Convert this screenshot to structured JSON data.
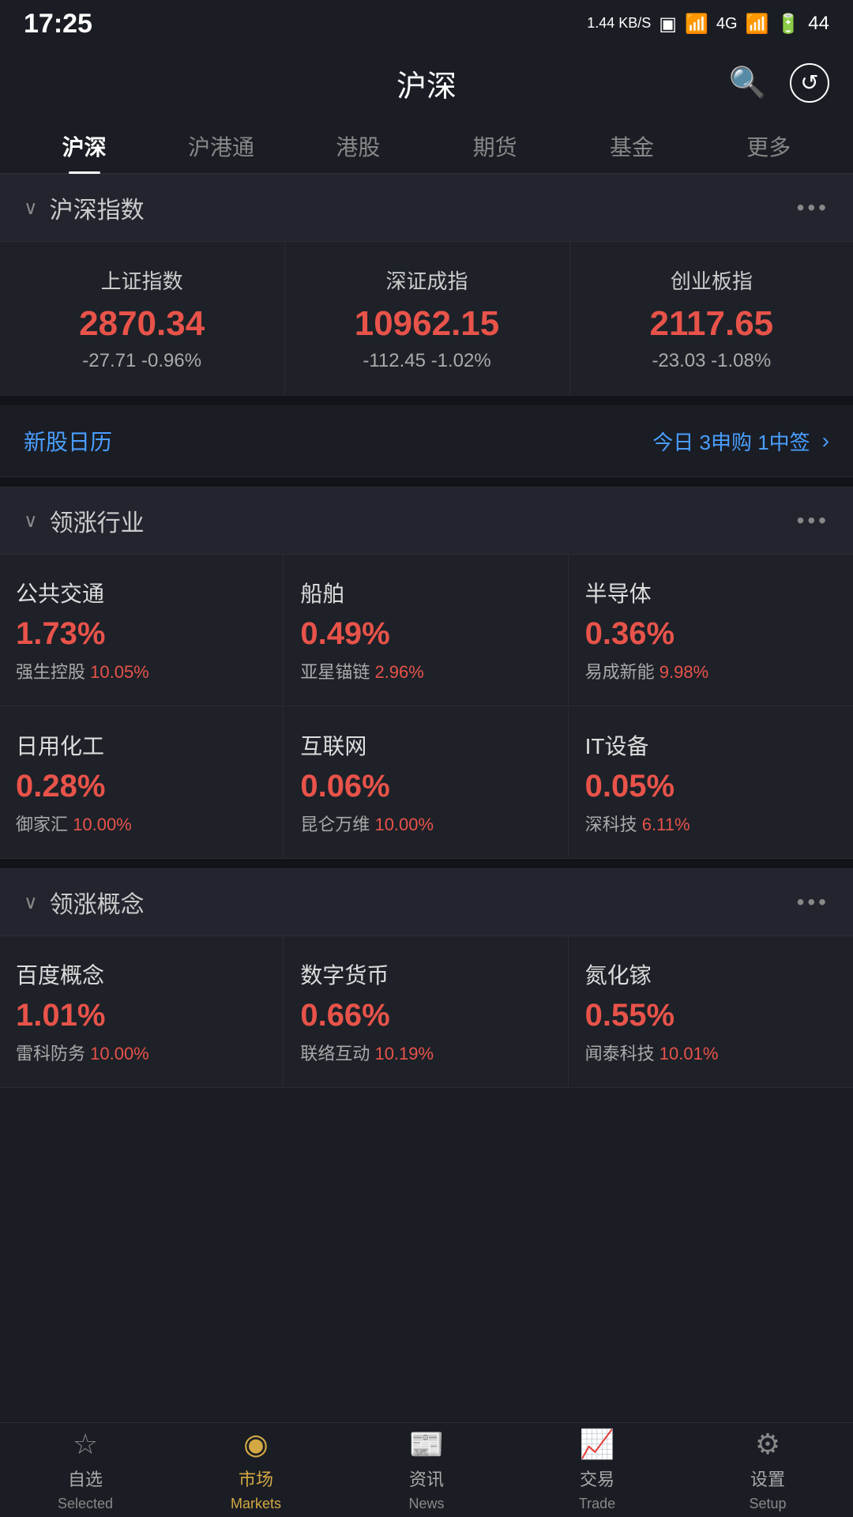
{
  "status": {
    "time": "17:25",
    "network": "1.44 KB/S",
    "battery": "44"
  },
  "header": {
    "title": "沪深",
    "search_label": "🔍",
    "refresh_label": "↻"
  },
  "tabs": [
    {
      "id": "hush",
      "label": "沪深",
      "active": true
    },
    {
      "id": "hutong",
      "label": "沪港通",
      "active": false
    },
    {
      "id": "gang",
      "label": "港股",
      "active": false
    },
    {
      "id": "futures",
      "label": "期货",
      "active": false
    },
    {
      "id": "fund",
      "label": "基金",
      "active": false
    },
    {
      "id": "more",
      "label": "更多",
      "active": false
    }
  ],
  "index_section": {
    "title": "沪深指数",
    "cards": [
      {
        "name": "上证指数",
        "value": "2870.34",
        "change": "-27.71 -0.96%",
        "color": "red"
      },
      {
        "name": "深证成指",
        "value": "10962.15",
        "change": "-112.45 -1.02%",
        "color": "red"
      },
      {
        "name": "创业板指",
        "value": "2117.65",
        "change": "-23.03 -1.08%",
        "color": "red"
      }
    ]
  },
  "ipo": {
    "title": "新股日历",
    "info": "今日 3申购 1中签",
    "arrow": "›"
  },
  "industry_section": {
    "title": "领涨行业",
    "cards": [
      {
        "name": "公共交通",
        "pct": "1.73%",
        "sub_name": "强生控股",
        "sub_pct": "10.05%"
      },
      {
        "name": "船舶",
        "pct": "0.49%",
        "sub_name": "亚星锚链",
        "sub_pct": "2.96%"
      },
      {
        "name": "半导体",
        "pct": "0.36%",
        "sub_name": "易成新能",
        "sub_pct": "9.98%"
      },
      {
        "name": "日用化工",
        "pct": "0.28%",
        "sub_name": "御家汇",
        "sub_pct": "10.00%"
      },
      {
        "name": "互联网",
        "pct": "0.06%",
        "sub_name": "昆仑万维",
        "sub_pct": "10.00%"
      },
      {
        "name": "IT设备",
        "pct": "0.05%",
        "sub_name": "深科技",
        "sub_pct": "6.11%"
      }
    ]
  },
  "concept_section": {
    "title": "领涨概念",
    "cards": [
      {
        "name": "百度概念",
        "pct": "1.01%",
        "sub_name": "雷科防务",
        "sub_pct": "10.00%"
      },
      {
        "name": "数字货币",
        "pct": "0.66%",
        "sub_name": "联络互动",
        "sub_pct": "10.19%"
      },
      {
        "name": "氮化镓",
        "pct": "0.55%",
        "sub_name": "闻泰科技",
        "sub_pct": "10.01%"
      }
    ]
  },
  "bottom_nav": [
    {
      "id": "selected",
      "label": "自选",
      "sub": "Selected",
      "active": false,
      "icon": "☆"
    },
    {
      "id": "markets",
      "label": "市场",
      "sub": "Markets",
      "active": true,
      "icon": "◎"
    },
    {
      "id": "news",
      "label": "资讯",
      "sub": "News",
      "active": false,
      "icon": "◻"
    },
    {
      "id": "trade",
      "label": "交易",
      "sub": "Trade",
      "active": false,
      "icon": "△"
    },
    {
      "id": "setup",
      "label": "设置",
      "sub": "Setup",
      "active": false,
      "icon": "⚙"
    }
  ]
}
